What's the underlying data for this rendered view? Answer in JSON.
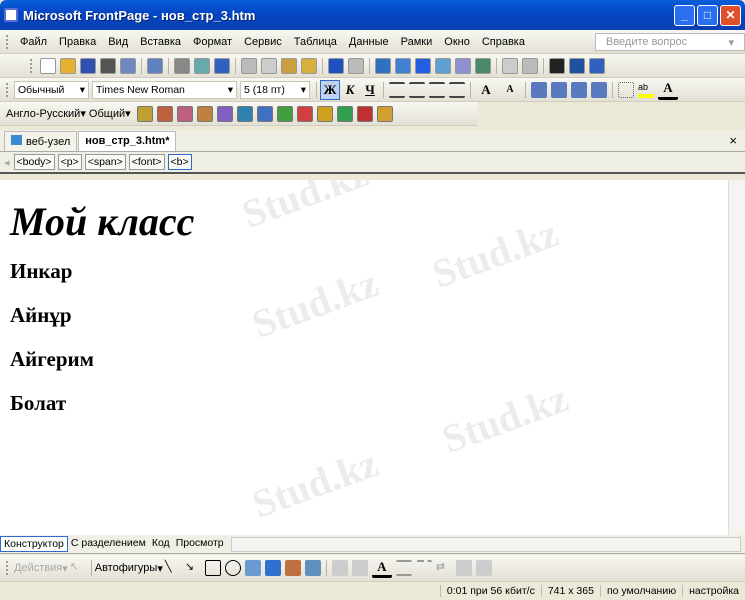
{
  "window": {
    "title": "Microsoft FrontPage - нов_стр_3.htm",
    "minimize": "_",
    "maximize": "□",
    "close": "✕"
  },
  "menu": [
    "Файл",
    "Правка",
    "Вид",
    "Вставка",
    "Формат",
    "Сервис",
    "Таблица",
    "Данные",
    "Рамки",
    "Окно",
    "Справка"
  ],
  "ask_placeholder": "Введите вопрос",
  "standard_icons": [
    [
      "new-icon",
      "#fff"
    ],
    [
      "open-icon",
      "#e8b030"
    ],
    [
      "save-icon",
      "#3050b0"
    ],
    [
      "find-icon",
      "#555"
    ],
    [
      "publish-icon",
      "#7088c0"
    ],
    [
      "folder-list-icon",
      "#6080c0"
    ],
    [
      "print-icon",
      "#888"
    ],
    [
      "preview-icon",
      "#6aa"
    ],
    [
      "spelling-icon",
      "#3060c0"
    ],
    [
      "cut-icon",
      "#bbb"
    ],
    [
      "copy-icon",
      "#ccc"
    ],
    [
      "paste-icon",
      "#c9a040"
    ],
    [
      "format-painter-icon",
      "#d8b040"
    ],
    [
      "undo-icon",
      "#2050c0"
    ],
    [
      "redo-icon",
      "#bbb"
    ],
    [
      "web-component-icon",
      "#3070c0"
    ],
    [
      "insert-table-icon",
      "#4080d0"
    ],
    [
      "layer-icon",
      "#2060e0"
    ],
    [
      "picture-icon",
      "#60a0d0"
    ],
    [
      "drawing-icon",
      "#9090d0"
    ],
    [
      "hyperlink-icon",
      "#4a8a6a"
    ],
    [
      "refresh-icon",
      "#ccc"
    ],
    [
      "stop-icon",
      "#bbb"
    ],
    [
      "show-all-icon",
      "#222"
    ],
    [
      "anchor-icon",
      "#2050a0"
    ],
    [
      "help-icon",
      "#3060c0"
    ]
  ],
  "format": {
    "style": "Обычный",
    "font": "Times New Roman",
    "size": "5 (18 пт)",
    "bold": "Ж",
    "italic": "К",
    "underline": "Ч",
    "font_color": "A",
    "highlight": "ab"
  },
  "toolbar3": {
    "dictionary": "Англо-Русский",
    "general": "Общий"
  },
  "toolbar3_icons": [
    [
      "translate-icon",
      "#c0a030"
    ],
    [
      "form1-icon",
      "#c06040"
    ],
    [
      "form2-icon",
      "#c06080"
    ],
    [
      "form3-icon",
      "#c08040"
    ],
    [
      "form4-icon",
      "#8060c0"
    ],
    [
      "books-icon",
      "#3080b0"
    ],
    [
      "search-doc-icon",
      "#4070c0"
    ],
    [
      "check-icon",
      "#40a040"
    ],
    [
      "list-icon",
      "#d04040"
    ],
    [
      "balloon-icon",
      "#d0a020"
    ],
    [
      "library-icon",
      "#30a050"
    ],
    [
      "tools-icon",
      "#c03030"
    ],
    [
      "help-doc-icon",
      "#d0a030"
    ]
  ],
  "tabs": {
    "site": "веб-узел",
    "page": "нов_стр_3.htm*",
    "close": "×"
  },
  "tags": [
    "<body>",
    "<p>",
    "<span>",
    "<font>",
    "<b>"
  ],
  "page": {
    "heading": "Мой класс",
    "names": [
      "Инкар",
      "Айнұр",
      "Айгерим",
      "Болат"
    ]
  },
  "watermark": "Stud.kz",
  "views": [
    "Конструктор",
    "С разделением",
    "Код",
    "Просмотр"
  ],
  "drawing": {
    "actions": "Действия",
    "autoshapes": "Автофигуры"
  },
  "status": [
    "0:01 при 56 кбит/с",
    "741 x 365",
    "по умолчанию",
    "настройка"
  ]
}
